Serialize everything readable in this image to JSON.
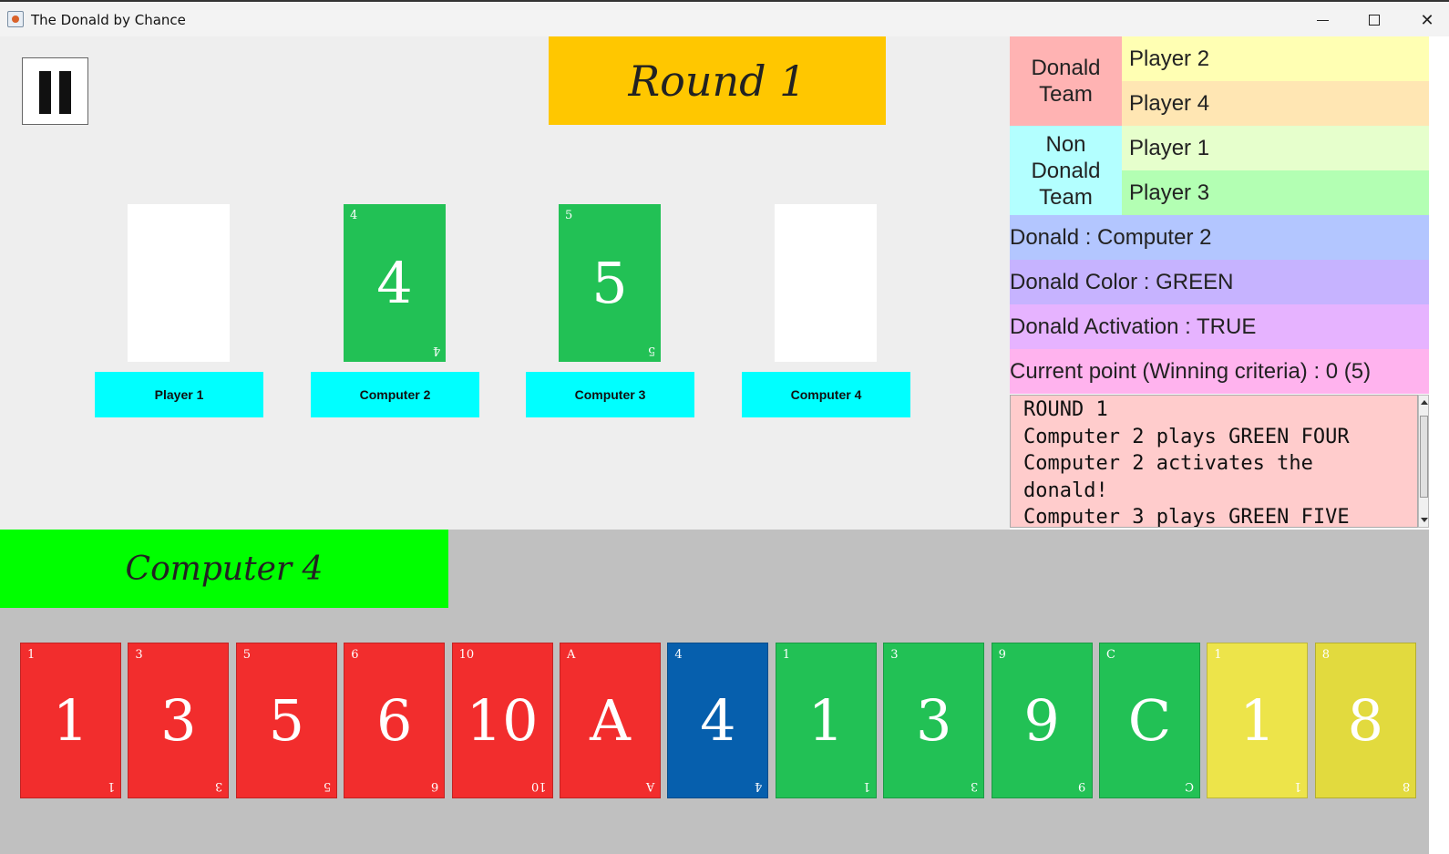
{
  "window": {
    "title": "The Donald by Chance"
  },
  "game": {
    "round_label": "Round 1",
    "slots": [
      {
        "name": "Player 1",
        "card": null
      },
      {
        "name": "Computer 2",
        "card": {
          "value": "4",
          "color": "#22c155"
        }
      },
      {
        "name": "Computer 3",
        "card": {
          "value": "5",
          "color": "#22c155"
        }
      },
      {
        "name": "Computer 4",
        "card": null
      }
    ]
  },
  "panel": {
    "donald_team_label": "Donald Team",
    "donald_team": [
      "Player 2",
      "Player 4"
    ],
    "non_donald_team_label": "Non Donald Team",
    "non_donald_team": [
      "Player 1",
      "Player 3"
    ],
    "donald": "Donald : Computer 2",
    "donald_color": "Donald Color : GREEN",
    "donald_activation": "Donald Activation : TRUE",
    "current_point": "Current point (Winning criteria) : 0 (5)",
    "log": "ROUND 1\nComputer 2 plays GREEN FOUR\nComputer 2 activates the donald!\nComputer 3 plays GREEN FIVE"
  },
  "hand": {
    "turn_label": "Computer 4",
    "cards": [
      {
        "value": "1",
        "color": "#f22d2d"
      },
      {
        "value": "3",
        "color": "#f22d2d"
      },
      {
        "value": "5",
        "color": "#f22d2d"
      },
      {
        "value": "6",
        "color": "#f22d2d"
      },
      {
        "value": "10",
        "color": "#f22d2d"
      },
      {
        "value": "A",
        "color": "#f22d2d"
      },
      {
        "value": "4",
        "color": "#065fad"
      },
      {
        "value": "1",
        "color": "#22c155"
      },
      {
        "value": "3",
        "color": "#22c155"
      },
      {
        "value": "9",
        "color": "#22c155"
      },
      {
        "value": "C",
        "color": "#22c155"
      },
      {
        "value": "1",
        "color": "#ede44a"
      },
      {
        "value": "8",
        "color": "#e2da3e"
      }
    ]
  },
  "colors": {
    "donald_team_bg": "#ffb3b3",
    "non_donald_team_bg": "#b3ffff",
    "player2_bg": "#ffffb3",
    "player4_bg": "#ffe6b3",
    "player1_bg": "#e6ffcc",
    "player3_bg": "#b3ffb3",
    "donald_bg": "#b3c6ff",
    "donald_color_bg": "#c6b3ff",
    "donald_activation_bg": "#e6b3ff",
    "current_point_bg": "#ffb3ee"
  }
}
